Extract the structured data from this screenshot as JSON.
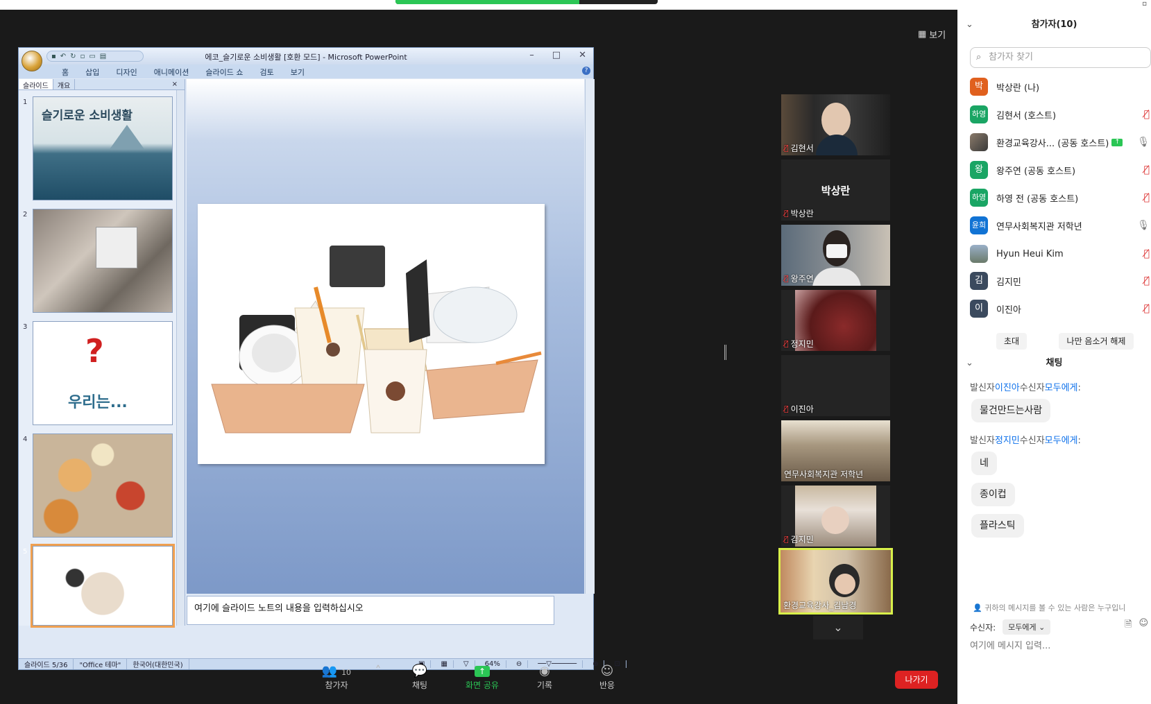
{
  "view_label": "보기",
  "ppt": {
    "title": "에코_슬기로운 소비생활 [호환 모드] - Microsoft PowerPoint",
    "ribbon_tabs": [
      "홈",
      "삽입",
      "디자인",
      "애니메이션",
      "슬라이드 쇼",
      "검토",
      "보기"
    ],
    "panel_tabs": [
      "슬라이드",
      "개요"
    ],
    "thumbs": [
      {
        "num": "1",
        "text": "슬기로운 소비생활"
      },
      {
        "num": "2",
        "text": ""
      },
      {
        "num": "3",
        "text": "우리는..."
      },
      {
        "num": "4",
        "text": ""
      },
      {
        "num": "5",
        "text": ""
      }
    ],
    "notes_placeholder": "여기에 슬라이드 노트의 내용을 입력하십시오",
    "status": {
      "slide": "슬라이드 5/36",
      "theme": "\"Office 테마\"",
      "lang": "한국어(대한민국)",
      "zoom": "64%"
    }
  },
  "videos": [
    {
      "name": "김현서",
      "muted": true,
      "kind": "camera"
    },
    {
      "name": "박상란",
      "muted": true,
      "kind": "name",
      "big": "박상란"
    },
    {
      "name": "왕주연",
      "muted": true,
      "kind": "camera"
    },
    {
      "name": "정지민",
      "muted": true,
      "kind": "camera"
    },
    {
      "name": "이진아",
      "muted": true,
      "kind": "off"
    },
    {
      "name": "연무사회복지관 저학년",
      "muted": false,
      "kind": "camera"
    },
    {
      "name": "김지민",
      "muted": true,
      "kind": "camera"
    },
    {
      "name": "환경교육강사_김남경",
      "muted": false,
      "kind": "camera",
      "active": true
    }
  ],
  "toolbar": {
    "participants": "참가자",
    "participants_count": "10",
    "chat": "채팅",
    "share": "화면 공유",
    "record": "기록",
    "reactions": "반응",
    "leave": "나가기"
  },
  "panel": {
    "participants_title": "참가자(10)",
    "search_placeholder": "참가자 찾기",
    "participants": [
      {
        "avatar": "박",
        "color": "#e0601e",
        "name": "박상란 (나)",
        "icon": ""
      },
      {
        "avatar": "하영",
        "color": "#1aa564",
        "name": "김현서 (호스트)",
        "icon": "muted"
      },
      {
        "avatar": "",
        "color": "#6b5a45",
        "name": "환경교육강사... (공동 호스트)",
        "icon": "mic",
        "sharing": true
      },
      {
        "avatar": "왕",
        "color": "#1aa564",
        "name": "왕주연 (공동 호스트)",
        "icon": "muted"
      },
      {
        "avatar": "하영",
        "color": "#1aa564",
        "name": "하영 전 (공동 호스트)",
        "icon": "muted"
      },
      {
        "avatar": "윤희",
        "color": "#1173d4",
        "name": "연무사회복지관 저학년",
        "icon": "mic"
      },
      {
        "avatar": "",
        "color": "#7a8a9a",
        "name": "Hyun Heui Kim",
        "icon": "muted"
      },
      {
        "avatar": "김",
        "color": "#3b4a5e",
        "name": "김지민",
        "icon": "muted"
      },
      {
        "avatar": "이",
        "color": "#3b4a5e",
        "name": "이진아",
        "icon": "muted"
      }
    ],
    "invite": "초대",
    "unmute_me": "나만 음소거 해제",
    "chat_title": "채팅",
    "chat": [
      {
        "sender": "이진아",
        "recipient": "모두에게",
        "messages": [
          "물건만드는사람"
        ]
      },
      {
        "sender": "정지민",
        "recipient": "모두에게",
        "messages": [
          "네",
          "종이컵",
          "플라스틱"
        ]
      }
    ],
    "sender_prefix": "발신자",
    "recipient_prefix": "수신자",
    "recipient_suffix": ":",
    "notice": "귀하의 메시지를 볼 수 있는 사람은 누구입니",
    "to_label": "수신자:",
    "to_value": "모두에게",
    "input_placeholder": "여기에 메시지 입력..."
  }
}
